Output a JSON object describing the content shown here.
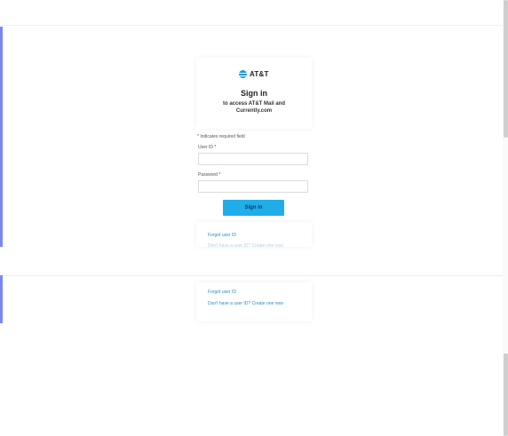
{
  "brand": {
    "name": "AT&T",
    "logo_icon": "globe-icon",
    "accent_color": "#1faee9"
  },
  "header": {
    "title": "Sign in",
    "subtitle": "to access AT&T Mail and Currently.com"
  },
  "form": {
    "required_note": "* Indicates required field",
    "user_id_label": "User ID",
    "user_id_value": "",
    "password_label": "Password",
    "password_value": "",
    "required_marker": "*",
    "signin_label": "Sign in"
  },
  "links": {
    "forgot_user_id": "Forgot user ID",
    "forgot_user_id_2": "Forgot user ID",
    "dont_have_user_id": "Don't have a user ID? Create one now"
  },
  "colors": {
    "button": "#1faee9",
    "link": "#2a8ccd",
    "side_accent": "#7b86f5"
  }
}
